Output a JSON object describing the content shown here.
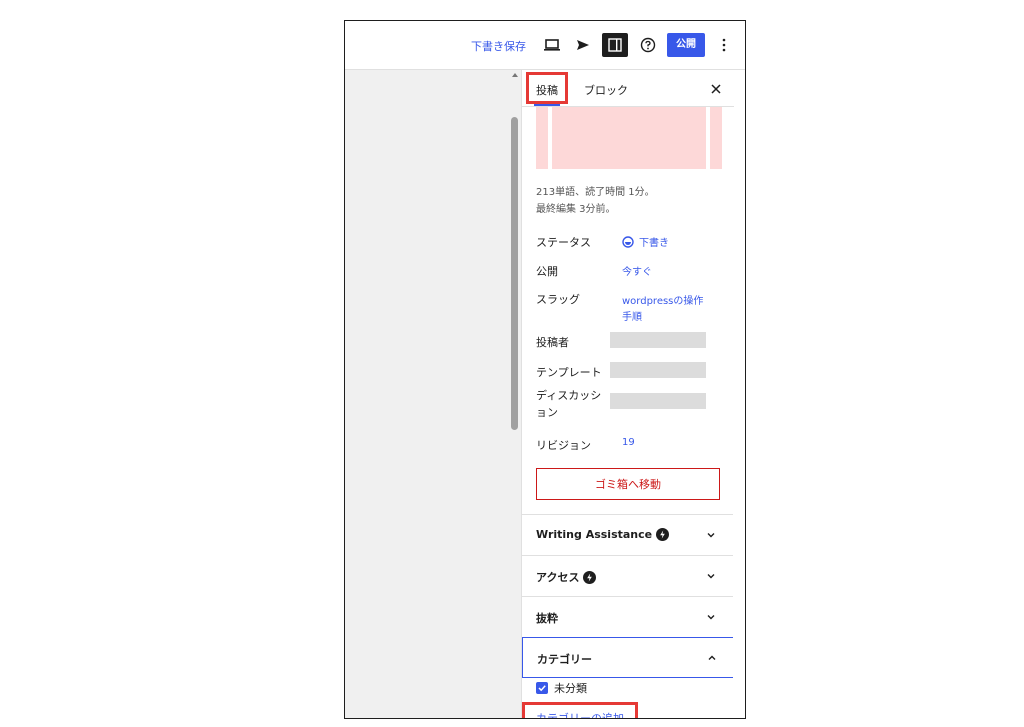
{
  "topbar": {
    "save_draft": "下書き保存",
    "publish": "公開",
    "icons": [
      "preview-icon",
      "send-icon",
      "settings-panel-icon",
      "help-icon",
      "more-icon"
    ]
  },
  "sidebar": {
    "tabs": {
      "post": "投稿",
      "block": "ブロック"
    },
    "meta": {
      "words": "213単語、読了時間 1分。",
      "last_edited": "最終編集 3分前。"
    },
    "rows": {
      "status_label": "ステータス",
      "status_value": "下書き",
      "publish_label": "公開",
      "publish_value": "今すぐ",
      "slug_label": "スラッグ",
      "slug_value_1": "wordpressの操作",
      "slug_value_2": "手順",
      "author_label": "投稿者",
      "template_label": "テンプレート",
      "discussion_label_1": "ディスカッシ",
      "discussion_label_2": "ョン",
      "revisions_label": "リビジョン",
      "revisions_value": "19"
    },
    "trash_button": "ゴミ箱へ移動",
    "sections": {
      "writing": "Writing Assistance",
      "access": "アクセス",
      "excerpt": "抜粋",
      "category": "カテゴリー"
    },
    "category": {
      "uncategorized": "未分類",
      "checked": true,
      "add_link": "カテゴリーの追加"
    }
  },
  "colors": {
    "accent": "#3858e9",
    "danger": "#cc1818",
    "highlight": "#e53935",
    "featured_bg": "#fdd8d8"
  }
}
